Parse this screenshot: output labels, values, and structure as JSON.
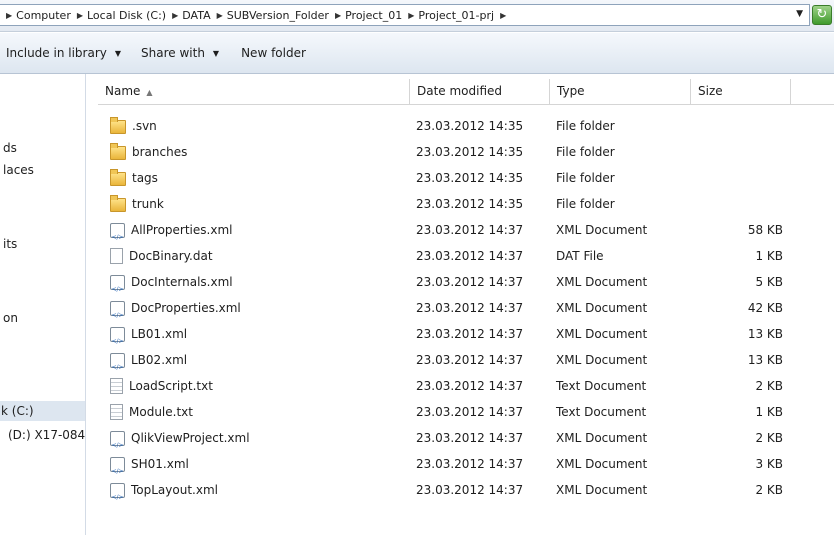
{
  "address": {
    "crumbs": [
      "Computer",
      "Local Disk (C:)",
      "DATA",
      "SUBVersion_Folder",
      "Project_01",
      "Project_01-prj"
    ]
  },
  "toolbar": {
    "include_label": "Include in library",
    "share_label": "Share with",
    "new_folder_label": "New folder"
  },
  "nav": {
    "items": [
      "ds",
      "laces",
      "its",
      "on",
      "k (C:)",
      "(D:) X17-084"
    ]
  },
  "columns": {
    "name": "Name",
    "date": "Date modified",
    "type": "Type",
    "size": "Size"
  },
  "files": [
    {
      "name": ".svn",
      "date": "23.03.2012 14:35",
      "type": "File folder",
      "size": "",
      "icon": "folder-icon"
    },
    {
      "name": "branches",
      "date": "23.03.2012 14:35",
      "type": "File folder",
      "size": "",
      "icon": "folder-icon"
    },
    {
      "name": "tags",
      "date": "23.03.2012 14:35",
      "type": "File folder",
      "size": "",
      "icon": "folder-icon"
    },
    {
      "name": "trunk",
      "date": "23.03.2012 14:35",
      "type": "File folder",
      "size": "",
      "icon": "folder-icon"
    },
    {
      "name": "AllProperties.xml",
      "date": "23.03.2012 14:37",
      "type": "XML Document",
      "size": "58 KB",
      "icon": "xml-file-icon"
    },
    {
      "name": "DocBinary.dat",
      "date": "23.03.2012 14:37",
      "type": "DAT File",
      "size": "1 KB",
      "icon": "blank-file-icon"
    },
    {
      "name": "DocInternals.xml",
      "date": "23.03.2012 14:37",
      "type": "XML Document",
      "size": "5 KB",
      "icon": "xml-file-icon"
    },
    {
      "name": "DocProperties.xml",
      "date": "23.03.2012 14:37",
      "type": "XML Document",
      "size": "42 KB",
      "icon": "xml-file-icon"
    },
    {
      "name": "LB01.xml",
      "date": "23.03.2012 14:37",
      "type": "XML Document",
      "size": "13 KB",
      "icon": "xml-file-icon"
    },
    {
      "name": "LB02.xml",
      "date": "23.03.2012 14:37",
      "type": "XML Document",
      "size": "13 KB",
      "icon": "xml-file-icon"
    },
    {
      "name": "LoadScript.txt",
      "date": "23.03.2012 14:37",
      "type": "Text Document",
      "size": "2 KB",
      "icon": "text-file-icon"
    },
    {
      "name": "Module.txt",
      "date": "23.03.2012 14:37",
      "type": "Text Document",
      "size": "1 KB",
      "icon": "text-file-icon"
    },
    {
      "name": "QlikViewProject.xml",
      "date": "23.03.2012 14:37",
      "type": "XML Document",
      "size": "2 KB",
      "icon": "xml-file-icon"
    },
    {
      "name": "SH01.xml",
      "date": "23.03.2012 14:37",
      "type": "XML Document",
      "size": "3 KB",
      "icon": "xml-file-icon"
    },
    {
      "name": "TopLayout.xml",
      "date": "23.03.2012 14:37",
      "type": "XML Document",
      "size": "2 KB",
      "icon": "xml-file-icon"
    }
  ]
}
